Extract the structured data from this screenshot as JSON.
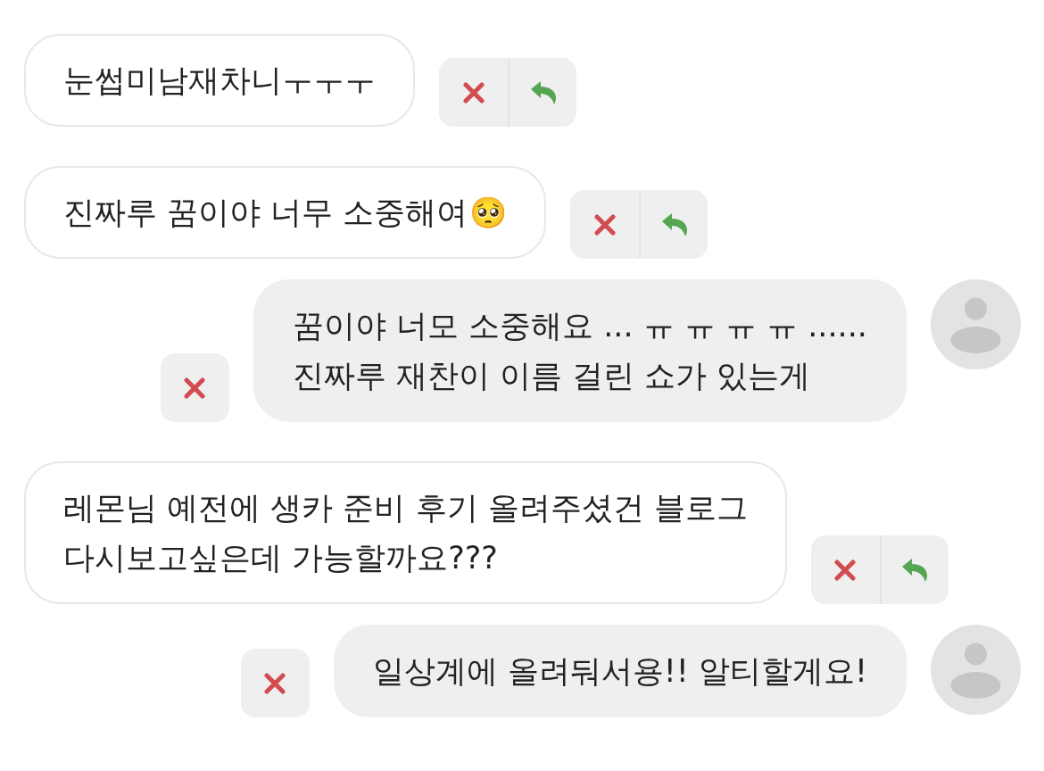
{
  "messages": [
    {
      "kind": "received",
      "text": "눈썹미남재차니ㅜㅜㅜ"
    },
    {
      "kind": "received",
      "text": "진짜루 꿈이야 너무 소중해여",
      "emoji": "🥺"
    },
    {
      "kind": "sent",
      "text": "꿈이야 너모 소중해요 ... ㅠ ㅠ ㅠ ㅠ ......\n진짜루 재찬이 이름 걸린 쇼가 있는게"
    },
    {
      "kind": "received",
      "text": "레몬님 예전에 생카 준비 후기 올려주셨건 블로그\n다시보고싶은데 가능할까요???"
    },
    {
      "kind": "sent",
      "text": "일상계에 올려둬서용!! 알티할게요!"
    }
  ]
}
